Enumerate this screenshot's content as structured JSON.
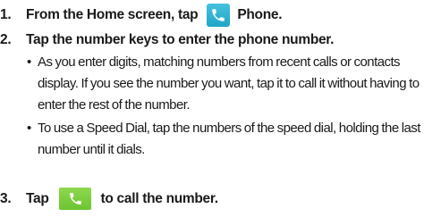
{
  "steps": [
    {
      "number": "1.",
      "text_before": "From the Home screen, tap",
      "icon": "phone-icon",
      "text_after": "Phone."
    },
    {
      "number": "2.",
      "text": "Tap the number keys to enter the phone number."
    },
    {
      "number": "3.",
      "text_before": "Tap",
      "icon": "call-button-icon",
      "text_after": "to call the number."
    }
  ],
  "bullets": [
    {
      "marker": "•",
      "text": "As you enter digits, matching numbers from recent calls or contacts display. If you see the number you want, tap it to call it without having to enter the rest of the number."
    },
    {
      "marker": "•",
      "text": "To use a Speed Dial, tap the numbers of the speed dial, holding the last number until it dials."
    }
  ],
  "colors": {
    "phone_icon": "#2fb2d4",
    "call_button": "#7ccd3f",
    "text": "#1a1a1a"
  }
}
